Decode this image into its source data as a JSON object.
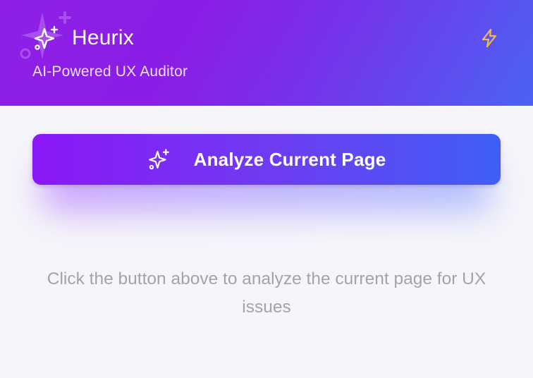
{
  "header": {
    "title": "Heurix",
    "subtitle": "AI-Powered UX Auditor",
    "logo_icon": "sparkles-icon",
    "action_icon": "lightning-bolt-icon"
  },
  "main": {
    "analyze_button_label": "Analyze Current Page",
    "analyze_button_icon": "sparkles-icon",
    "hint_text": "Click the button above to analyze the current page for UX issues"
  },
  "colors": {
    "header_gradient_start": "#8f1fe6",
    "header_gradient_end": "#4a63f3",
    "button_gradient_start": "#8b17f7",
    "button_gradient_end": "#3e5ff6",
    "bolt_color": "#f2b84b",
    "hint_color": "#a3a3ab",
    "background": "#f6f5fa"
  }
}
